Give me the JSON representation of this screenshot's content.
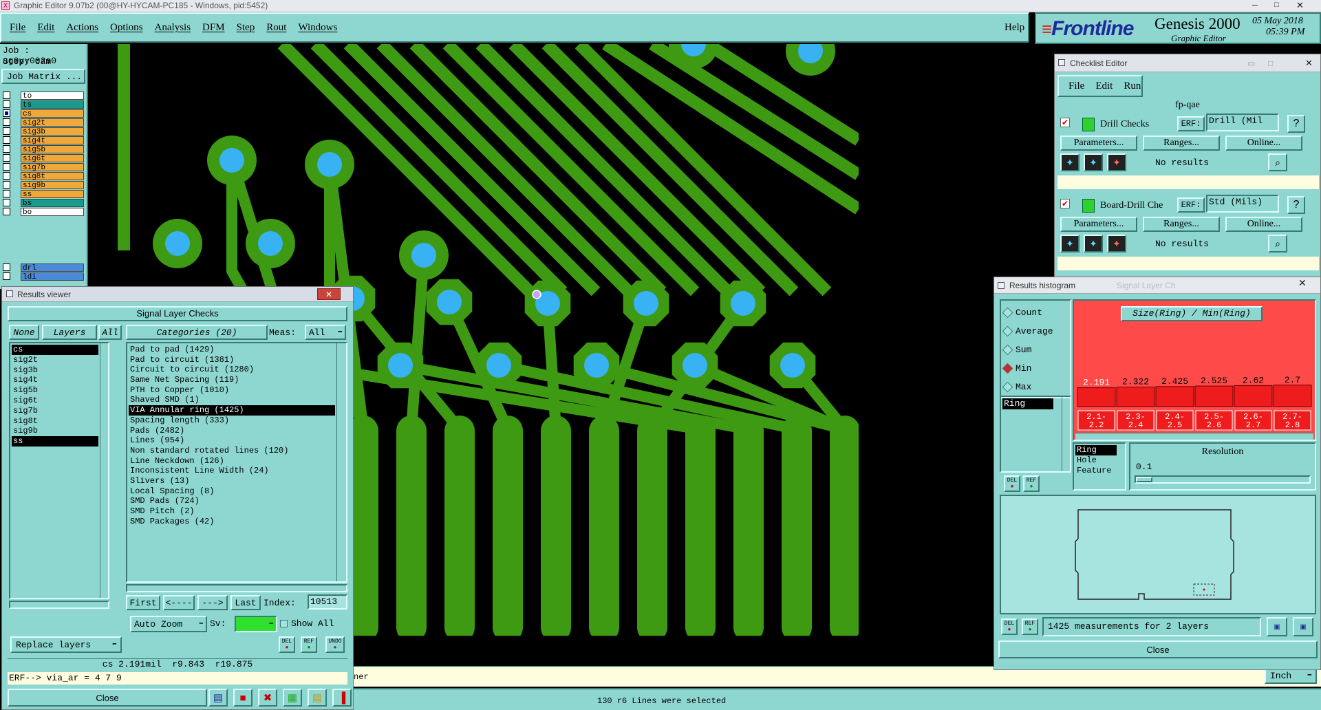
{
  "titlebar": {
    "title": "Graphic Editor 9.07b2 (00@HY-HYCAM-PC185 - Windows, pid:5452)"
  },
  "menubar": {
    "items": [
      "File",
      "Edit",
      "Actions",
      "Options",
      "Analysis",
      "DFM",
      "Step",
      "Rout",
      "Windows"
    ],
    "help": "Help"
  },
  "brand": {
    "logo": "Frontline",
    "product": "Genesis 2000",
    "subtitle": "Graphic Editor",
    "date": "05 May 2018",
    "time": "05:39 PM"
  },
  "job": {
    "job": "Job : ag0yy002a0",
    "step": "Step: cam",
    "matrix": "Job Matrix ..."
  },
  "layers": [
    {
      "name": "to",
      "color": "#ffffff"
    },
    {
      "name": "ts",
      "color": "#1a9a8a"
    },
    {
      "name": "cs",
      "color": "#f0a838"
    },
    {
      "name": "sig2t",
      "color": "#f0a838"
    },
    {
      "name": "sig3b",
      "color": "#f0a838"
    },
    {
      "name": "sig4t",
      "color": "#f0a838"
    },
    {
      "name": "sig5b",
      "color": "#f0a838"
    },
    {
      "name": "sig6t",
      "color": "#f0a838"
    },
    {
      "name": "sig7b",
      "color": "#f0a838"
    },
    {
      "name": "sig8t",
      "color": "#f0a838"
    },
    {
      "name": "sig9b",
      "color": "#f0a838"
    },
    {
      "name": "ss",
      "color": "#f0a838"
    },
    {
      "name": "bs",
      "color": "#1a9a8a"
    },
    {
      "name": "bo",
      "color": "#ffffff"
    }
  ],
  "layers2": [
    {
      "name": "drl",
      "color": "#4a8ad8"
    },
    {
      "name": "ldi",
      "color": "#4a8ad8"
    }
  ],
  "results_viewer": {
    "title": "Results viewer",
    "header": "Signal Layer Checks",
    "none": "None",
    "layers_btn": "Layers",
    "all": "All",
    "categories": "Categories (20)",
    "meas_label": "Meas:",
    "meas_value": "All",
    "layer_list": [
      "cs",
      "sig2t",
      "sig3b",
      "sig4t",
      "sig5b",
      "sig6t",
      "sig7b",
      "sig8t",
      "sig9b",
      "ss"
    ],
    "category_list": [
      "Pad to pad (1429)",
      "Pad to circuit (1381)",
      "Circuit to circuit (1280)",
      "Same Net Spacing (119)",
      "PTH to Copper (1010)",
      "Shaved SMD (1)",
      "VIA Annular ring (1425)",
      "Spacing length (333)",
      "Pads (2482)",
      "Lines (954)",
      "Non standard rotated lines (120)",
      "Line Neckdown (126)",
      "Inconsistent Line Width (24)",
      "Slivers (13)",
      "Local Spacing (8)",
      "SMD Pads (724)",
      "SMD Pitch (2)",
      "SMD Packages (42)"
    ],
    "first": "First",
    "prev": "<----",
    "next": "--->",
    "last": "Last",
    "index_label": "Index:",
    "index_value": "10513",
    "auto_zoom": "Auto Zoom",
    "sv": "Sv:",
    "show_all": "Show All",
    "replace_layers": "Replace layers",
    "del": "DEL",
    "ref": "REF",
    "undo": "UNDO",
    "status": "cs 2.191mil  r9.843  r19.875",
    "erf": "ERF--> via_ar = 4 7 9",
    "close": "Close"
  },
  "checklist": {
    "title": "Checklist Editor",
    "menu": [
      "File",
      "Edit",
      "Run"
    ],
    "name": "fp-qae",
    "checks": [
      {
        "label": "Drill Checks",
        "erf_label": "ERF:",
        "erf_value": "Drill (Mil",
        "status": "No results"
      },
      {
        "label": "Board-Drill Che",
        "erf_label": "ERF:",
        "erf_value": "Std (Mils)",
        "status": "No results"
      }
    ],
    "parameters": "Parameters...",
    "ranges": "Ranges...",
    "online": "Online...",
    "help": "?"
  },
  "histogram": {
    "title": "Results histogram",
    "ghost_title": "Signal Layer Ch",
    "modes": [
      "Count",
      "Average",
      "Sum",
      "Min",
      "Max"
    ],
    "selected_mode": "Min",
    "list_item": "Ring",
    "chart_title": "Size(Ring) / Min(Ring)",
    "types": [
      "Ring",
      "Hole",
      "Feature"
    ],
    "resolution_label": "Resolution",
    "resolution_value": "0.1",
    "measurements": "1425 measurements for 2 layers",
    "close": "Close"
  },
  "chart_data": {
    "type": "bar",
    "title": "Size(Ring) / Min(Ring)",
    "categories": [
      "2.1-2.2",
      "2.3-2.4",
      "2.4-2.5",
      "2.5-2.6",
      "2.6-2.7",
      "2.7-2.8"
    ],
    "values": [
      2.191,
      2.322,
      2.425,
      2.525,
      2.62,
      2.7
    ],
    "value_labels": [
      "2.191",
      "2.322",
      "2.425",
      "2.525",
      "2.62",
      "2.7"
    ],
    "category_lines": [
      [
        "2.1-",
        "2.2"
      ],
      [
        "2.3-",
        "2.4"
      ],
      [
        "2.4-",
        "2.5"
      ],
      [
        "2.5-",
        "2.6"
      ],
      [
        "2.6-",
        "2.7"
      ],
      [
        "2.7-",
        "2.8"
      ]
    ]
  },
  "statusbar": {
    "message": "130 r6 Lines were selected",
    "partial": "ner",
    "units": "Inch"
  },
  "colors": {
    "teal": "#8ed6d0",
    "copper": "#3e9a12",
    "pad": "#38b2f2",
    "bar": "#ee1c1c",
    "selected_bg": "#000000"
  }
}
